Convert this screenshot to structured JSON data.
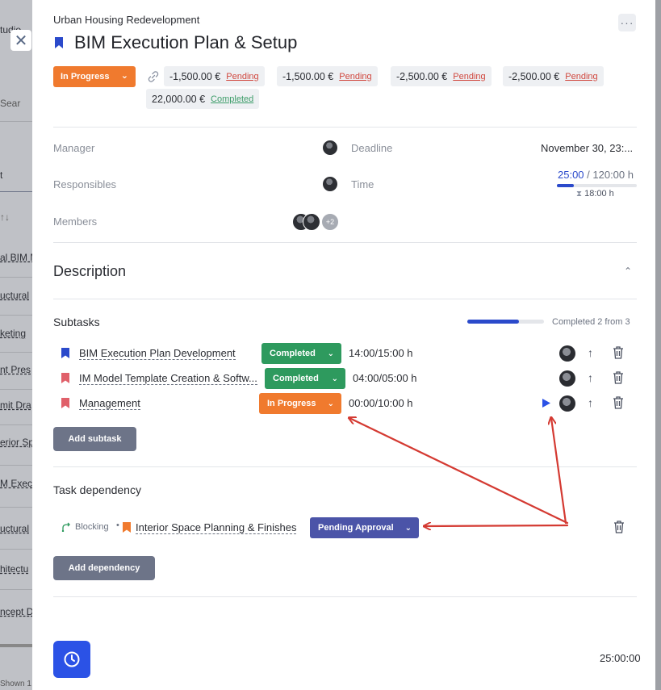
{
  "background": {
    "rows": [
      "tudio",
      "Sear",
      "t",
      "↑↓",
      "al BIM M",
      "uctural",
      "keting",
      "nt Pres",
      "mit Dra",
      "erior Sp",
      "M Exec",
      "uctural",
      "hitectu",
      "ncept D",
      "Shown 1"
    ]
  },
  "panel": {
    "project": "Urban Housing Redevelopment",
    "title": "BIM Execution Plan & Setup",
    "status": "In Progress",
    "payments": [
      {
        "amount": "-1,500.00 €",
        "status": "Pending"
      },
      {
        "amount": "-1,500.00 €",
        "status": "Pending"
      },
      {
        "amount": "-2,500.00 €",
        "status": "Pending"
      },
      {
        "amount": "-2,500.00 €",
        "status": "Pending"
      },
      {
        "amount": "22,000.00 €",
        "status": "Completed"
      }
    ],
    "labels": {
      "manager": "Manager",
      "responsibles": "Responsibles",
      "members": "Members",
      "deadline": "Deadline",
      "time": "Time"
    },
    "deadline_value": "November 30, 23:...",
    "time": {
      "spent": "25:00",
      "total": " / 120:00 h",
      "estimate": "18:00 h",
      "progress": 0.21
    },
    "members_extra": "+2",
    "description_title": "Description",
    "subtasks_title": "Subtasks",
    "subtasks_progress_text": "Completed 2 from 3",
    "subtasks_progress": 0.67,
    "subtasks": [
      {
        "name": "BIM Execution Plan Development",
        "status": "Completed",
        "hours": "14:00/15:00 h",
        "flag_color": "#2b4acb"
      },
      {
        "name": "IM Model Template Creation & Softw...",
        "status": "Completed",
        "hours": "04:00/05:00 h",
        "flag_color": "#e0606a"
      },
      {
        "name": "Management",
        "status": "In Progress",
        "hours": "00:00/10:00 h",
        "flag_color": "#e0606a"
      }
    ],
    "add_subtask": "Add subtask",
    "dependency_title": "Task dependency",
    "dependency": {
      "type": "Blocking",
      "separator": "•",
      "name": "Interior Space Planning & Finishes",
      "status": "Pending Approval"
    },
    "add_dependency": "Add dependency",
    "timer_value": "25:00:00"
  },
  "colors": {
    "accent": "#2b52e6",
    "orange": "#f07a2e",
    "green": "#2e9a5e",
    "purple": "#4b54a8",
    "arrow": "#d43a32"
  }
}
